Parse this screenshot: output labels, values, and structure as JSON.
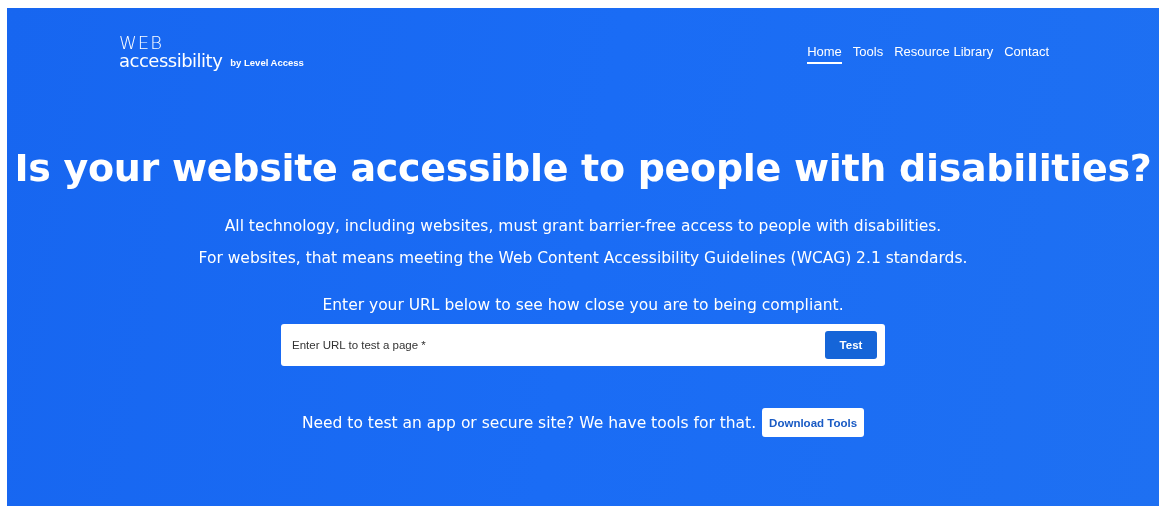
{
  "logo": {
    "wordmark": "WEB",
    "name": "accessibility",
    "byline": "by Level Access"
  },
  "nav": [
    {
      "label": "Home",
      "selected": true
    },
    {
      "label": "Tools",
      "selected": false
    },
    {
      "label": "Resource Library",
      "selected": false
    },
    {
      "label": "Contact",
      "selected": false
    }
  ],
  "hero": {
    "title": "Is your website accessible to people with disabilities?",
    "lines": [
      "All technology, including websites, must grant barrier-free access to people with disabilities.",
      "For websites, that means meeting the Web Content Accessibility Guidelines (WCAG) 2.1 standards."
    ],
    "prompt": "Enter your URL below to see how close you are to being compliant.",
    "url_field": {
      "placeholder": "Enter URL to test a page *"
    },
    "test_button": "Test",
    "tools_text": "Need to test an app or secure site? We have tools for that.",
    "tools_button": "Download Tools"
  }
}
